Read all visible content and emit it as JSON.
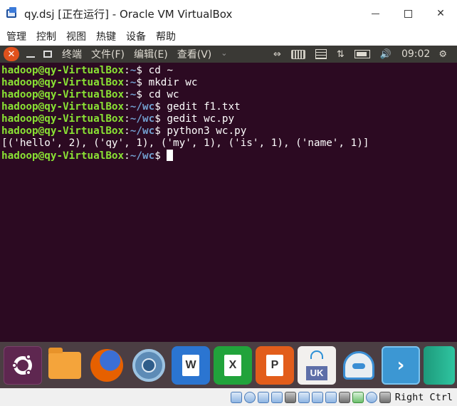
{
  "window": {
    "title": "qy.dsj [正在运行] - Oracle VM VirtualBox",
    "minimize": "—",
    "maximize": "☐",
    "close": "✕"
  },
  "vbox_menu": [
    "管理",
    "控制",
    "视图",
    "热键",
    "设备",
    "帮助"
  ],
  "guest_panel": {
    "close_glyph": "✕",
    "menus": [
      "终端",
      "文件(F)",
      "编辑(E)",
      "查看(V)"
    ],
    "more_arrow": "⌄",
    "clock": "09:02",
    "volume_glyph": "🔊",
    "network_glyph": "⇅",
    "power_glyph": "⚙",
    "transfer_glyph": "⇔"
  },
  "terminal": {
    "user_host": "hadoop@qy-VirtualBox",
    "lines": [
      {
        "path": "~",
        "command": "cd ~"
      },
      {
        "path": "~",
        "command": "mkdir wc"
      },
      {
        "path": "~",
        "command": "cd wc"
      },
      {
        "path": "~/wc",
        "command": "gedit f1.txt"
      },
      {
        "path": "~/wc",
        "command": "gedit wc.py"
      },
      {
        "path": "~/wc",
        "command": "python3 wc.py"
      }
    ],
    "output": "[('hello', 2), ('qy', 1), ('my', 1), ('is', 1), ('name', 1)]",
    "current_path": "~/wc"
  },
  "dock": {
    "writer_letter": "W",
    "calc_letter": "X",
    "impress_letter": "P",
    "software_label": "UK",
    "terminal_glyph": "›"
  },
  "statusbar": {
    "host_key": "Right Ctrl"
  },
  "colors": {
    "terminal_bg": "#2c0a22",
    "prompt_user": "#8ae234",
    "prompt_path": "#729fcf",
    "panel_bg": "#3a3935",
    "close_button": "#e0511c"
  }
}
